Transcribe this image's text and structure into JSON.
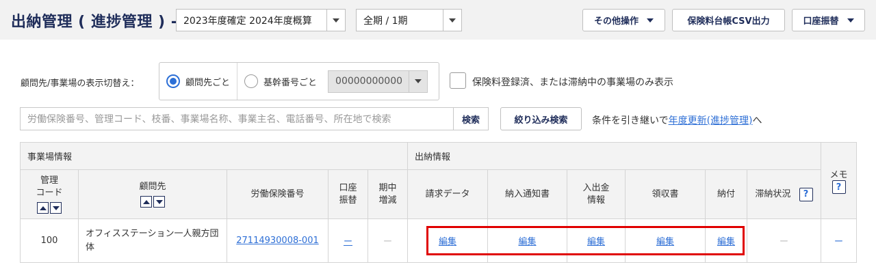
{
  "header": {
    "title": "出納管理 ( 進捗管理 ) -",
    "fiscal_select": "2023年度確定 2024年度概算",
    "period_select": "全期 / 1期",
    "other_ops_label": "その他操作",
    "csv_label": "保険料台帳CSV出力",
    "transfer_label": "口座振替"
  },
  "filters": {
    "display_toggle_label": "顧問先/事業場の表示切替え：",
    "radio_client": "顧問先ごと",
    "radio_base": "基幹番号ごと",
    "base_number": "00000000000",
    "checkbox_label": "保険料登録済、または滞納中の事業場のみ表示",
    "search_placeholder": "労働保険番号、管理コード、枝番、事業場名称、事業主名、電話番号、所在地で検索",
    "search_button": "検索",
    "refine_button": "絞り込み検索",
    "carry_text_prefix": "条件を引き継いで",
    "carry_link": "年度更新(進捗管理)",
    "carry_text_suffix": "へ"
  },
  "table": {
    "group_business": "事業場情報",
    "group_payment": "出納情報",
    "group_memo": "メモ",
    "col_code_line1": "管理",
    "col_code_line2": "コード",
    "col_client": "顧問先",
    "col_insurance_no": "労働保険番号",
    "col_transfer_line1": "口座",
    "col_transfer_line2": "振替",
    "col_change_line1": "期中",
    "col_change_line2": "増減",
    "col_invoice": "請求データ",
    "col_notice": "納入通知書",
    "col_inout_line1": "入出金",
    "col_inout_line2": "情報",
    "col_receipt": "領収書",
    "col_payment": "納付",
    "col_delinquent": "滞納状況",
    "help_mark": "?",
    "rows": [
      {
        "code": "100",
        "client": "オフィスステーション一人親方団体",
        "insurance_no": "27114930008-001",
        "transfer": "ー",
        "change": "ー",
        "invoice": "編集",
        "notice": "編集",
        "inout": "編集",
        "receipt": "編集",
        "payment": "編集",
        "delinquent": "ー",
        "memo": "ー"
      }
    ]
  },
  "colors": {
    "brand_navy": "#1f2d5a",
    "link_blue": "#2e6fd6",
    "highlight_red": "#e00000"
  }
}
